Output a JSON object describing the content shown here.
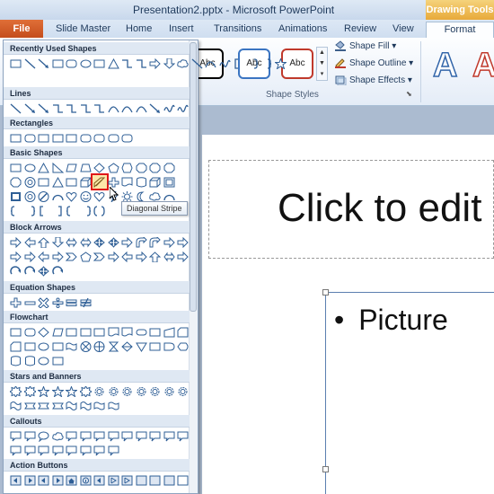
{
  "window": {
    "title": "Presentation2.pptx - Microsoft PowerPoint",
    "context_tab_group": "Drawing Tools"
  },
  "tabs": [
    "File",
    "Slide Master",
    "Home",
    "Insert",
    "Transitions",
    "Animations",
    "Review",
    "View",
    "Format"
  ],
  "ribbon": {
    "shape_style_samples": [
      "Abc",
      "Abc",
      "Abc"
    ],
    "shape_fill": "Shape Fill",
    "shape_outline": "Shape Outline",
    "shape_effects": "Shape Effects",
    "shape_styles_group": "Shape Styles",
    "wordart_letters": [
      "A",
      "A"
    ]
  },
  "gallery": {
    "sections": [
      {
        "name": "Recently Used Shapes"
      },
      {
        "name": "Lines"
      },
      {
        "name": "Rectangles"
      },
      {
        "name": "Basic Shapes"
      },
      {
        "name": "Block Arrows"
      },
      {
        "name": "Equation Shapes"
      },
      {
        "name": "Flowchart"
      },
      {
        "name": "Stars and Banners"
      },
      {
        "name": "Callouts"
      },
      {
        "name": "Action Buttons"
      }
    ],
    "selected_shape": "Diagonal Stripe",
    "tooltip": "Diagonal Stripe"
  },
  "slide": {
    "title_placeholder": "Click to edit",
    "bullet_text": "Picture"
  },
  "colors": {
    "file_tab": "#c44d1c",
    "drawing_tools": "#e8a93a",
    "selection": "#e01818"
  }
}
